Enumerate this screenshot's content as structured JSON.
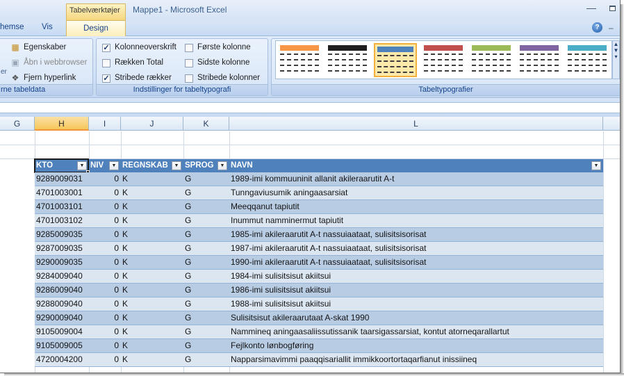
{
  "window": {
    "contextual_tab_group": "Tabelværktøjer",
    "title": "Mappe1 - Microsoft Excel"
  },
  "tabs": {
    "partial_left": "hemse",
    "vis": "Vis",
    "design": "Design"
  },
  "ribbon": {
    "external_data": {
      "label": "rne tabeldata",
      "partial_left_text": "er",
      "properties": "Egenskaber",
      "open_browser": "Åbn i webbrowser",
      "unlink": "Fjern hyperlink"
    },
    "style_options": {
      "label": "Indstillinger for tabeltypografi",
      "header_row": {
        "label": "Kolonneoverskrift",
        "checked": true
      },
      "total_row": {
        "label": "Rækken Total",
        "checked": false
      },
      "banded_rows": {
        "label": "Stribede rækker",
        "checked": true
      },
      "first_column": {
        "label": "Første kolonne",
        "checked": false
      },
      "last_column": {
        "label": "Sidste kolonne",
        "checked": false
      },
      "banded_columns": {
        "label": "Stribede kolonner",
        "checked": false
      }
    },
    "table_styles": {
      "label": "Tabeltypografier",
      "swatches": [
        {
          "name": "style-orange",
          "color": "#f79646"
        },
        {
          "name": "style-black",
          "color": "#1f1f1f"
        },
        {
          "name": "style-blue",
          "color": "#4f81bd",
          "selected": true
        },
        {
          "name": "style-red",
          "color": "#c0504d"
        },
        {
          "name": "style-green",
          "color": "#9bbb59"
        },
        {
          "name": "style-purple",
          "color": "#8064a2"
        },
        {
          "name": "style-aqua",
          "color": "#4bacc6"
        }
      ]
    }
  },
  "columns": [
    "G",
    "H",
    "I",
    "J",
    "K",
    "L"
  ],
  "active_column": "H",
  "table": {
    "headers": [
      "KTO",
      "NIV",
      "REGNSKAB",
      "SPROG",
      "NAVN"
    ],
    "rows": [
      {
        "kto": "9289009031",
        "niv": "0",
        "regnskab": "K",
        "sprog": "G",
        "navn": "1989-imi kommuuninit allanit akileraarutit A-t"
      },
      {
        "kto": "4701003001",
        "niv": "0",
        "regnskab": "K",
        "sprog": "G",
        "navn": "Tunngaviusumik aningaasarsiat"
      },
      {
        "kto": "4701003101",
        "niv": "0",
        "regnskab": "K",
        "sprog": "G",
        "navn": "Meeqqanut tapiutit"
      },
      {
        "kto": "4701003102",
        "niv": "0",
        "regnskab": "K",
        "sprog": "G",
        "navn": "Inummut namminermut tapiutit"
      },
      {
        "kto": "9285009035",
        "niv": "0",
        "regnskab": "K",
        "sprog": "G",
        "navn": "1985-imi akileraarutit A-t nassuiaataat, sulisitsisorisat"
      },
      {
        "kto": "9287009035",
        "niv": "0",
        "regnskab": "K",
        "sprog": "G",
        "navn": "1987-imi akileraarutit A-t nassuiaataat, sulisitsisorisat"
      },
      {
        "kto": "9290009035",
        "niv": "0",
        "regnskab": "K",
        "sprog": "G",
        "navn": "1990-imi akileraarutit A-t nassuiaataat, sulisitsisorisat"
      },
      {
        "kto": "9284009040",
        "niv": "0",
        "regnskab": "K",
        "sprog": "G",
        "navn": "1984-imi sulisitsisut akiitsui"
      },
      {
        "kto": "9286009040",
        "niv": "0",
        "regnskab": "K",
        "sprog": "G",
        "navn": "1986-imi sulisitsisut akiitsui"
      },
      {
        "kto": "9288009040",
        "niv": "0",
        "regnskab": "K",
        "sprog": "G",
        "navn": "1988-imi sulisitsisut akiitsui"
      },
      {
        "kto": "9290009040",
        "niv": "0",
        "regnskab": "K",
        "sprog": "G",
        "navn": "Sulisitsisut akileraarutaat A-skat 1990"
      },
      {
        "kto": "9105009004",
        "niv": "0",
        "regnskab": "K",
        "sprog": "G",
        "navn": "Nammineq aningaasaliissutissanik taarsigassarsiat, kontut atorneqarallartut"
      },
      {
        "kto": "9105009005",
        "niv": "0",
        "regnskab": "K",
        "sprog": "G",
        "navn": "Fejlkonto lønbogføring"
      },
      {
        "kto": "4720004200",
        "niv": "0",
        "regnskab": "K",
        "sprog": "G",
        "navn": "Napparsimavimmi paaqqisariallit immikkoortortaqarfianut inissiineq"
      }
    ]
  }
}
